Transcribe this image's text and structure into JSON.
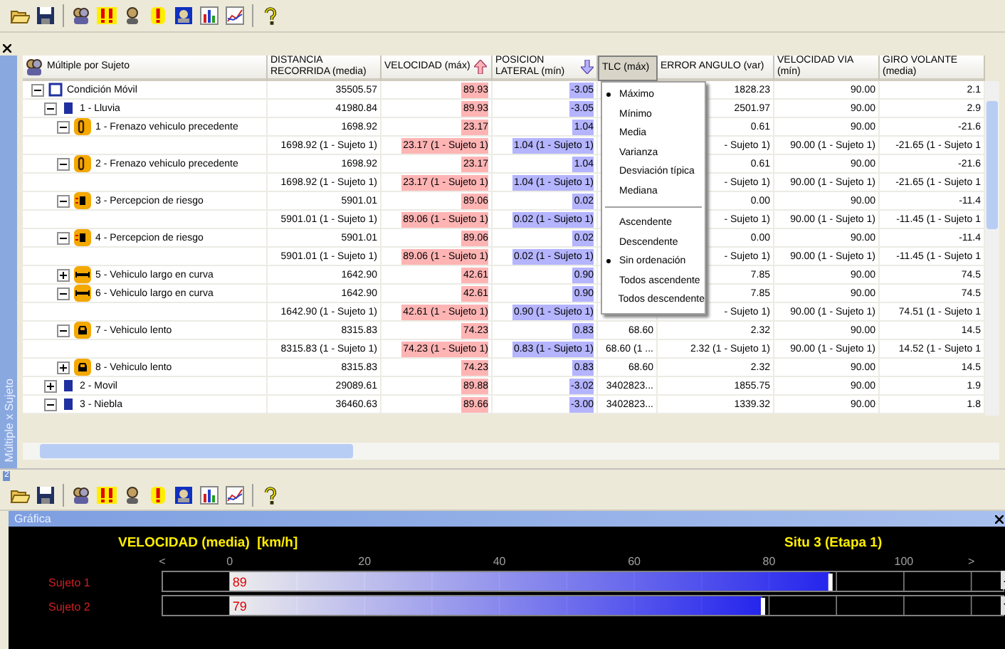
{
  "grid_panel": {
    "side_tab": "Múltiple x Sujeto",
    "tree_header": {
      "label": "Múltiple por Sujeto"
    },
    "columns": [
      {
        "label": "DISTANCIA RECORRIDA (media)",
        "pressed": false,
        "sorted_up": false,
        "sorted_down": false
      },
      {
        "label": "VELOCIDAD (máx)",
        "pressed": false,
        "sorted_up": true,
        "sorted_down": false,
        "color": "#ffb4b4"
      },
      {
        "label": "POSICION LATERAL (mín)",
        "pressed": false,
        "sorted_up": false,
        "sorted_down": true,
        "color": "#b4b4ff"
      },
      {
        "label": "TLC (máx)",
        "pressed": true,
        "sorted_up": false,
        "sorted_down": false
      },
      {
        "label": "ERROR ANGULO (var)",
        "pressed": false,
        "sorted_up": false,
        "sorted_down": false
      },
      {
        "label": "VELOCIDAD VIA (mín)",
        "pressed": false,
        "sorted_up": false,
        "sorted_down": false
      },
      {
        "label": "GIRO VOLANTE (media)",
        "pressed": false,
        "sorted_up": false,
        "sorted_down": false
      }
    ],
    "rows": [
      {
        "kind": "group",
        "label": "Condición Móvil",
        "expanded": true,
        "cells": [
          "35505.57",
          "89.93",
          "-3.05",
          null,
          "1828.23",
          "90.00",
          "2.1"
        ],
        "children": [
          {
            "kind": "weather",
            "label": "1 - Lluvia",
            "expanded": true,
            "cells": [
              "41980.84",
              "89.93",
              "-3.05",
              null,
              "2501.97",
              "90.00",
              "2.9"
            ],
            "children": [
              {
                "kind": "brake",
                "label": "1 - Frenazo vehiculo precedente",
                "expanded": true,
                "cells": [
                  "1698.92",
                  "23.17",
                  "1.04",
                  null,
                  "0.61",
                  "90.00",
                  "-21.6"
                ],
                "children": [
                  {
                    "kind": "detail",
                    "cells": [
                      "1698.92 (1 - Sujeto 1)",
                      "23.17 (1 - Sujeto 1)",
                      "1.04 (1 - Sujeto 1)",
                      null,
                      "- Sujeto 1)",
                      "90.00 (1 - Sujeto 1)",
                      "-21.65 (1 - Sujeto 1"
                    ]
                  }
                ]
              },
              {
                "kind": "brake",
                "label": "2 - Frenazo vehiculo precedente",
                "expanded": true,
                "cells": [
                  "1698.92",
                  "23.17",
                  "1.04",
                  null,
                  "0.61",
                  "90.00",
                  "-21.6"
                ],
                "children": [
                  {
                    "kind": "detail",
                    "cells": [
                      "1698.92 (1 - Sujeto 1)",
                      "23.17 (1 - Sujeto 1)",
                      "1.04 (1 - Sujeto 1)",
                      null,
                      "- Sujeto 1)",
                      "90.00 (1 - Sujeto 1)",
                      "-21.65 (1 - Sujeto 1"
                    ]
                  }
                ]
              },
              {
                "kind": "risk",
                "label": "3 - Percepcion de riesgo",
                "expanded": true,
                "cells": [
                  "5901.01",
                  "89.06",
                  "0.02",
                  null,
                  "0.00",
                  "90.00",
                  "-11.4"
                ],
                "children": [
                  {
                    "kind": "detail",
                    "cells": [
                      "5901.01 (1 - Sujeto 1)",
                      "89.06 (1 - Sujeto 1)",
                      "0.02 (1 - Sujeto 1)",
                      null,
                      "- Sujeto 1)",
                      "90.00 (1 - Sujeto 1)",
                      "-11.45 (1 - Sujeto 1"
                    ]
                  }
                ]
              },
              {
                "kind": "risk",
                "label": "4 - Percepcion de riesgo",
                "expanded": true,
                "cells": [
                  "5901.01",
                  "89.06",
                  "0.02",
                  null,
                  "0.00",
                  "90.00",
                  "-11.4"
                ],
                "children": [
                  {
                    "kind": "detail",
                    "cells": [
                      "5901.01 (1 - Sujeto 1)",
                      "89.06 (1 - Sujeto 1)",
                      "0.02 (1 - Sujeto 1)",
                      null,
                      "- Sujeto 1)",
                      "90.00 (1 - Sujeto 1)",
                      "-11.45 (1 - Sujeto 1"
                    ]
                  }
                ]
              },
              {
                "kind": "long-vehicle",
                "label": "5 - Vehiculo largo en curva",
                "expanded": false,
                "cells": [
                  "1642.90",
                  "42.61",
                  "0.90",
                  null,
                  "7.85",
                  "90.00",
                  "74.5"
                ]
              },
              {
                "kind": "long-vehicle",
                "label": "6 - Vehiculo largo en curva",
                "expanded": true,
                "cells": [
                  "1642.90",
                  "42.61",
                  "0.90",
                  null,
                  "7.85",
                  "90.00",
                  "74.5"
                ],
                "children": [
                  {
                    "kind": "detail",
                    "cells": [
                      "1642.90 (1 - Sujeto 1)",
                      "42.61 (1 - Sujeto 1)",
                      "0.90 (1 - Sujeto 1)",
                      null,
                      "- Sujeto 1)",
                      "90.00 (1 - Sujeto 1)",
                      "74.51 (1 - Sujeto 1"
                    ]
                  }
                ]
              },
              {
                "kind": "slow-vehicle",
                "label": "7 - Vehiculo lento",
                "expanded": true,
                "cells": [
                  "8315.83",
                  "74.23",
                  "0.83",
                  "68.60",
                  "2.32",
                  "90.00",
                  "14.5"
                ],
                "children": [
                  {
                    "kind": "detail",
                    "cells": [
                      "8315.83 (1 - Sujeto 1)",
                      "74.23 (1 - Sujeto 1)",
                      "0.83 (1 - Sujeto 1)",
                      "68.60 (1 ...",
                      "2.32 (1 - Sujeto 1)",
                      "90.00 (1 - Sujeto 1)",
                      "14.52 (1 - Sujeto 1"
                    ]
                  }
                ]
              },
              {
                "kind": "slow-vehicle",
                "label": "8 - Vehiculo lento",
                "expanded": false,
                "cells": [
                  "8315.83",
                  "74.23",
                  "0.83",
                  "68.60",
                  "2.32",
                  "90.00",
                  "14.5"
                ]
              }
            ]
          },
          {
            "kind": "weather",
            "label": "2 - Movil",
            "expanded": false,
            "cells": [
              "29089.61",
              "89.88",
              "-3.02",
              "3402823...",
              "1855.75",
              "90.00",
              "1.9"
            ]
          },
          {
            "kind": "weather",
            "label": "3 - Niebla",
            "expanded": true,
            "cells": [
              "36460.63",
              "89.66",
              "-3.00",
              "3402823...",
              "1339.32",
              "90.00",
              "1.8"
            ]
          }
        ]
      }
    ],
    "context_menu": [
      {
        "kind": "item",
        "label": "Máximo",
        "selected": true
      },
      {
        "kind": "item",
        "label": "Mínimo",
        "selected": false
      },
      {
        "kind": "item",
        "label": "Media",
        "selected": false
      },
      {
        "kind": "item",
        "label": "Varianza",
        "selected": false
      },
      {
        "kind": "item",
        "label": "Desviación típica",
        "selected": false
      },
      {
        "kind": "item",
        "label": "Mediana",
        "selected": false
      },
      {
        "kind": "separator"
      },
      {
        "kind": "item",
        "label": "Ascendente",
        "selected": false
      },
      {
        "kind": "item",
        "label": "Descendente",
        "selected": false
      },
      {
        "kind": "item",
        "label": "Sin ordenación",
        "selected": true
      },
      {
        "kind": "item",
        "label": "Todos ascendente",
        "selected": false
      },
      {
        "kind": "item",
        "label": "Todos descendente",
        "selected": false
      }
    ]
  },
  "splitter_label": "2",
  "chart_panel": {
    "title": "Gráfica",
    "subtitle": "Situ 3 (Etapa 1)",
    "chart_data": {
      "type": "bar",
      "orientation": "horizontal",
      "title": "VELOCIDAD (media)  [km/h]",
      "categories": [
        "Sujeto 1",
        "Sujeto 2"
      ],
      "series": [
        {
          "color": "#2828ff",
          "values": [
            89,
            79
          ]
        }
      ],
      "xlim": [
        -10,
        115
      ],
      "xticks": [
        {
          "value": -10,
          "label": "<"
        },
        0,
        20,
        40,
        60,
        80,
        100,
        {
          "value": 110,
          "label": ">"
        }
      ],
      "grid": true,
      "data_labels": true
    }
  }
}
